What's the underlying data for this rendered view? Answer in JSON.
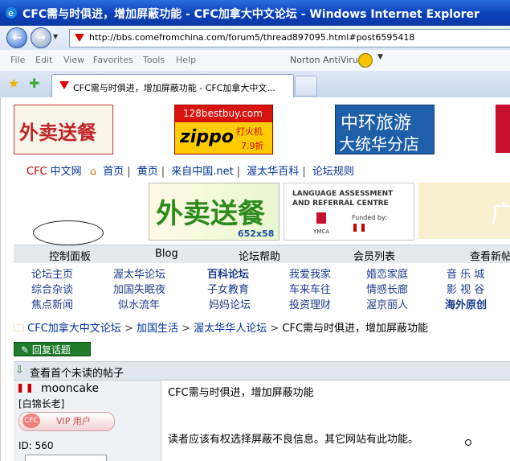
{
  "window": {
    "title": "CFC需与时俱进，增加屏蔽功能 - CFC加拿大中文论坛 - Windows Internet Explorer",
    "url": "http://bbs.comefromchina.com/forum5/thread897095.html#post6595418",
    "menu": [
      "File",
      "Edit",
      "View",
      "Favorites",
      "Tools",
      "Help"
    ],
    "toolbar_extra": "Norton AntiVirus",
    "tab_title": "CFC需与时俱进，增加屏蔽功能 - CFC加拿大中文..."
  },
  "banners": {
    "ad1": "外卖送餐",
    "ad2_top": "128bestbuy.com",
    "ad2_brand": "zippo",
    "ad2_sub": "打火机",
    "ad2_price": "7.9折",
    "ad3_line1": "中环旅游",
    "ad3_line2": "大统华分店",
    "ad4_main": "外卖送餐",
    "ad4_size": "652x58",
    "ad5_line1": "LANGUAGE ASSESSMENT",
    "ad5_line2": "AND REFERRAL CENTRE",
    "ad5_funded": "Funded by:",
    "ad5_ymca": "YMCA",
    "ad6": "广"
  },
  "topnav": {
    "brand_red": "CFC",
    "brand_rest": "中文网",
    "items": [
      "首页",
      "黄页",
      "来自中国.net",
      "渥太华百科",
      "论坛规则"
    ]
  },
  "forumrow": [
    "控制面板",
    "Blog",
    "论坛帮助",
    "会员列表",
    "查看新帖"
  ],
  "links": [
    [
      "论坛主页",
      "渥太华论坛",
      "百科论坛",
      "我爱我家",
      "婚恋家庭",
      "音 乐 城"
    ],
    [
      "综合杂谈",
      "加国失眠夜",
      "子女教育",
      "车来车往",
      "情感长廊",
      "影 视 谷"
    ],
    [
      "焦点新闻",
      "似水流年",
      "妈妈论坛",
      "投资理财",
      "渥京丽人",
      "海外原创"
    ]
  ],
  "breadcrumb": [
    "CFC加拿大中文论坛",
    "加国生活",
    "渥太华华人论坛",
    "CFC需与时俱进，增加屏蔽功能"
  ],
  "reply_button": "回复话题",
  "first_unread": "查看首个未读的帖子",
  "post": {
    "username": "mooncake",
    "rank": "[白锦长老]",
    "vip_label": "VIP 用户",
    "vip_badge": "CFC",
    "id_label": "ID: 560",
    "title": "CFC需与时俱进，增加屏蔽功能",
    "body": "读者应该有权选择屏蔽不良信息。其它网站有此功能。"
  }
}
